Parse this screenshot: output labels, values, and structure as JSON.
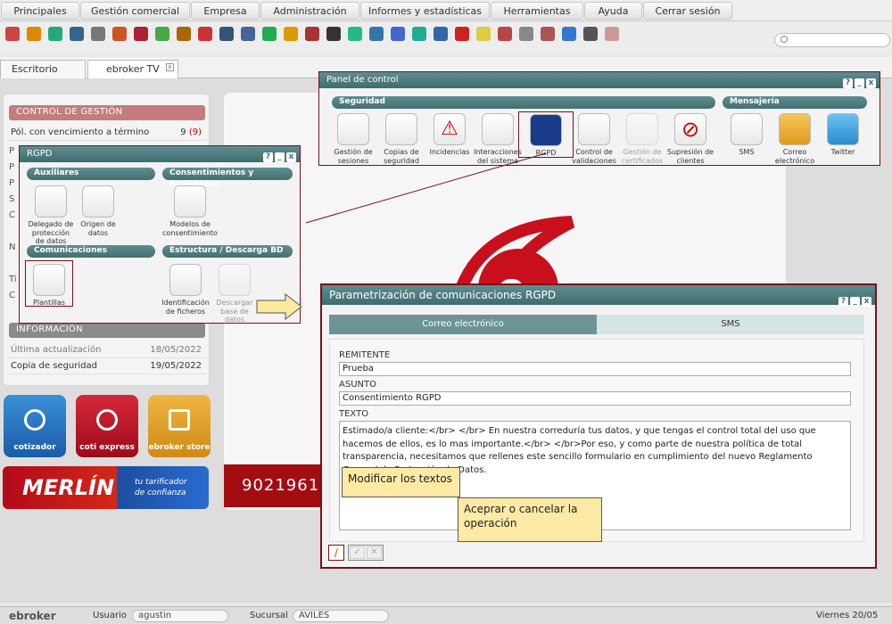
{
  "menu": [
    "Principales",
    "Gestión comercial",
    "Empresa",
    "Administración",
    "Informes y estadísticas",
    "Herramientas",
    "Ayuda",
    "Cerrar sesión"
  ],
  "toolbar_icons": [
    "box-icon",
    "user-icon",
    "users-icon",
    "card-icon",
    "list-icon",
    "fire-icon",
    "target-icon",
    "pen-icon",
    "briefcase-icon",
    "medkit-icon",
    "book-icon",
    "stack-icon",
    "traffic-icon",
    "person-money-icon",
    "money-icon",
    "euro-icon",
    "lifebuoy-icon",
    "earth-icon",
    "info-icon",
    "arrow-icon",
    "calendar-icon",
    "g-icon",
    "bulb-icon",
    "stamp-icon",
    "doc-icon",
    "edit-icon",
    "phone-icon",
    "plug-icon",
    "help-icon"
  ],
  "tabs": [
    "Escritorio",
    "ebroker TV"
  ],
  "left": {
    "control_title": "CONTROL DE GESTIÓN",
    "pol_label": "Pól. con vencimiento a término",
    "pol_value": "9",
    "pol_sub": "(9)",
    "info_title": "INFORMACIÓN",
    "ultima_label": "Última actualización",
    "ultima_value": "18/05/2022",
    "copia_label": "Copia de seguridad",
    "copia_value": "19/05/2022"
  },
  "tiles": {
    "cotizador": "cotizador",
    "coti": "coti express",
    "store": "ebroker store"
  },
  "merlin": {
    "name": "MERLÍN",
    "tag1": "tu tarificador",
    "tag2": "de confianza"
  },
  "redband": "9021961",
  "panel": {
    "title": "Panel de control",
    "grp_seg": "Seguridad",
    "grp_msg": "Mensajería",
    "items": [
      {
        "l1": "Gestión de",
        "l2": "sesiones"
      },
      {
        "l1": "Copias de",
        "l2": "seguridad"
      },
      {
        "l1": "Incidencias",
        "l2": ""
      },
      {
        "l1": "Interacciones",
        "l2": "del sistema"
      },
      {
        "l1": "RGPD",
        "l2": ""
      },
      {
        "l1": "Control de",
        "l2": "validaciones"
      },
      {
        "l1": "Gestión de",
        "l2": "certificados"
      },
      {
        "l1": "Supresión de",
        "l2": "clientes"
      },
      {
        "l1": "SMS",
        "l2": ""
      },
      {
        "l1": "Correo",
        "l2": "electrónico"
      },
      {
        "l1": "Twitter",
        "l2": ""
      }
    ]
  },
  "rgpd": {
    "title": "RGPD",
    "aux": "Auxiliares",
    "cons": "Consentimientos y finalidades",
    "com": "Comunicaciones",
    "est": "Estructura / Descarga BD",
    "delegado": [
      "Delegado de",
      "protección",
      "de datos"
    ],
    "origen": [
      "Origen de",
      "datos"
    ],
    "modelos": [
      "Modelos de",
      "consentimiento"
    ],
    "plantillas": [
      "Plantillas"
    ],
    "ident": [
      "Identificación",
      "de ficheros"
    ],
    "descargar": [
      "Descargar",
      "base de",
      "datos"
    ]
  },
  "param": {
    "title": "Parametrización de comunicaciones RGPD",
    "tab_email": "Correo electrónico",
    "tab_sms": "SMS",
    "remitente_label": "REMITENTE",
    "remitente": "Prueba",
    "asunto_label": "ASUNTO",
    "asunto": "Consentimiento RGPD",
    "texto_label": "TEXTO",
    "texto": "Estimado/a cliente:</br> </br> En nuestra correduría tus datos, y que tengas el control total del uso que hacemos de ellos, es lo mas importante.</br> </br>Por eso, y como parte de nuestra política de total transparencia, necesitamos que rellenes este sencillo formulario en cumplimiento del nuevo Reglamento General de Protección de Datos."
  },
  "callouts": {
    "modificar": "Modificar los textos",
    "aceptar": "Aceprar o cancelar la operación"
  },
  "status": {
    "brand": "ebroker",
    "usuario_label": "Usuario",
    "usuario": "agustin",
    "sucursal_label": "Sucursal",
    "sucursal": "AVILES",
    "date": "Viernes 20/05"
  }
}
